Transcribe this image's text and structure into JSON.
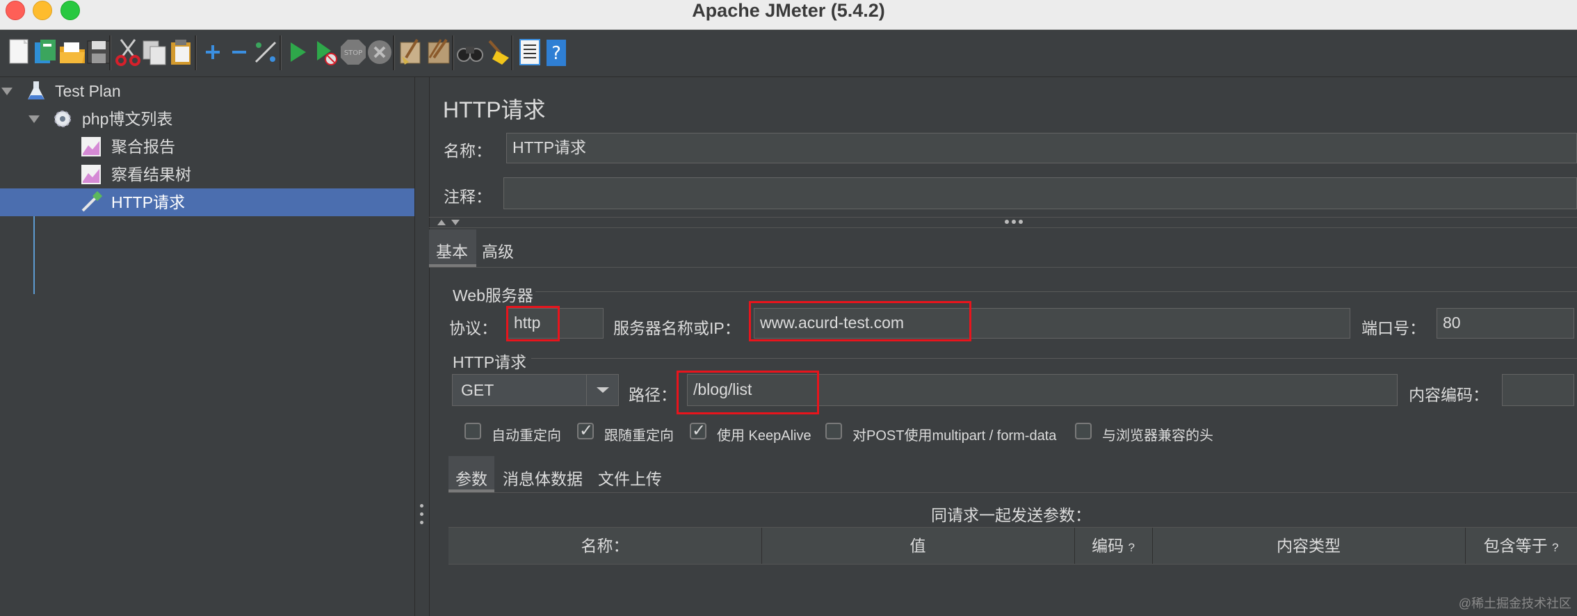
{
  "window": {
    "title": "Apache JMeter (5.4.2)"
  },
  "toolbar": {
    "icons": [
      "new-icon",
      "templates-icon",
      "open-icon",
      "save-icon",
      "cut-icon",
      "copy-icon",
      "paste-icon",
      "expand-icon",
      "collapse-icon",
      "toggle-icon",
      "start-icon",
      "start-no-pause-icon",
      "stop-icon",
      "shutdown-icon",
      "clear-icon",
      "clear-all-icon",
      "search-icon",
      "reset-search-icon",
      "function-helper-icon",
      "help-icon"
    ]
  },
  "tree": {
    "items": [
      {
        "label": "Test Plan"
      },
      {
        "label": "php博文列表"
      },
      {
        "label": "聚合报告"
      },
      {
        "label": "察看结果树"
      },
      {
        "label": "HTTP请求"
      }
    ]
  },
  "panel": {
    "title": "HTTP请求",
    "name_label": "名称：",
    "name_value": "HTTP请求",
    "comment_label": "注释：",
    "comment_value": "",
    "tabs": [
      "基本",
      "高级"
    ],
    "web_server": {
      "group_title": "Web服务器",
      "protocol_label": "协议：",
      "protocol_value": "http",
      "server_label": "服务器名称或IP：",
      "server_value": "www.acurd-test.com",
      "port_label": "端口号：",
      "port_value": "80"
    },
    "http_request": {
      "group_title": "HTTP请求",
      "method": "GET",
      "path_label": "路径：",
      "path_value": "/blog/list",
      "encoding_label": "内容编码：",
      "encoding_value": ""
    },
    "checkboxes": [
      {
        "label": "自动重定向",
        "checked": false
      },
      {
        "label": "跟随重定向",
        "checked": true
      },
      {
        "label": "使用 KeepAlive",
        "checked": true
      },
      {
        "label": "对POST使用multipart / form-data",
        "checked": false
      },
      {
        "label": "与浏览器兼容的头",
        "checked": false
      }
    ],
    "subtabs": [
      "参数",
      "消息体数据",
      "文件上传"
    ],
    "params_caption": "同请求一起发送参数：",
    "columns": [
      "名称：",
      "值",
      "编码",
      "内容类型",
      "包含等于"
    ],
    "q_mark": "?"
  },
  "watermark": "@稀土掘金技术社区"
}
